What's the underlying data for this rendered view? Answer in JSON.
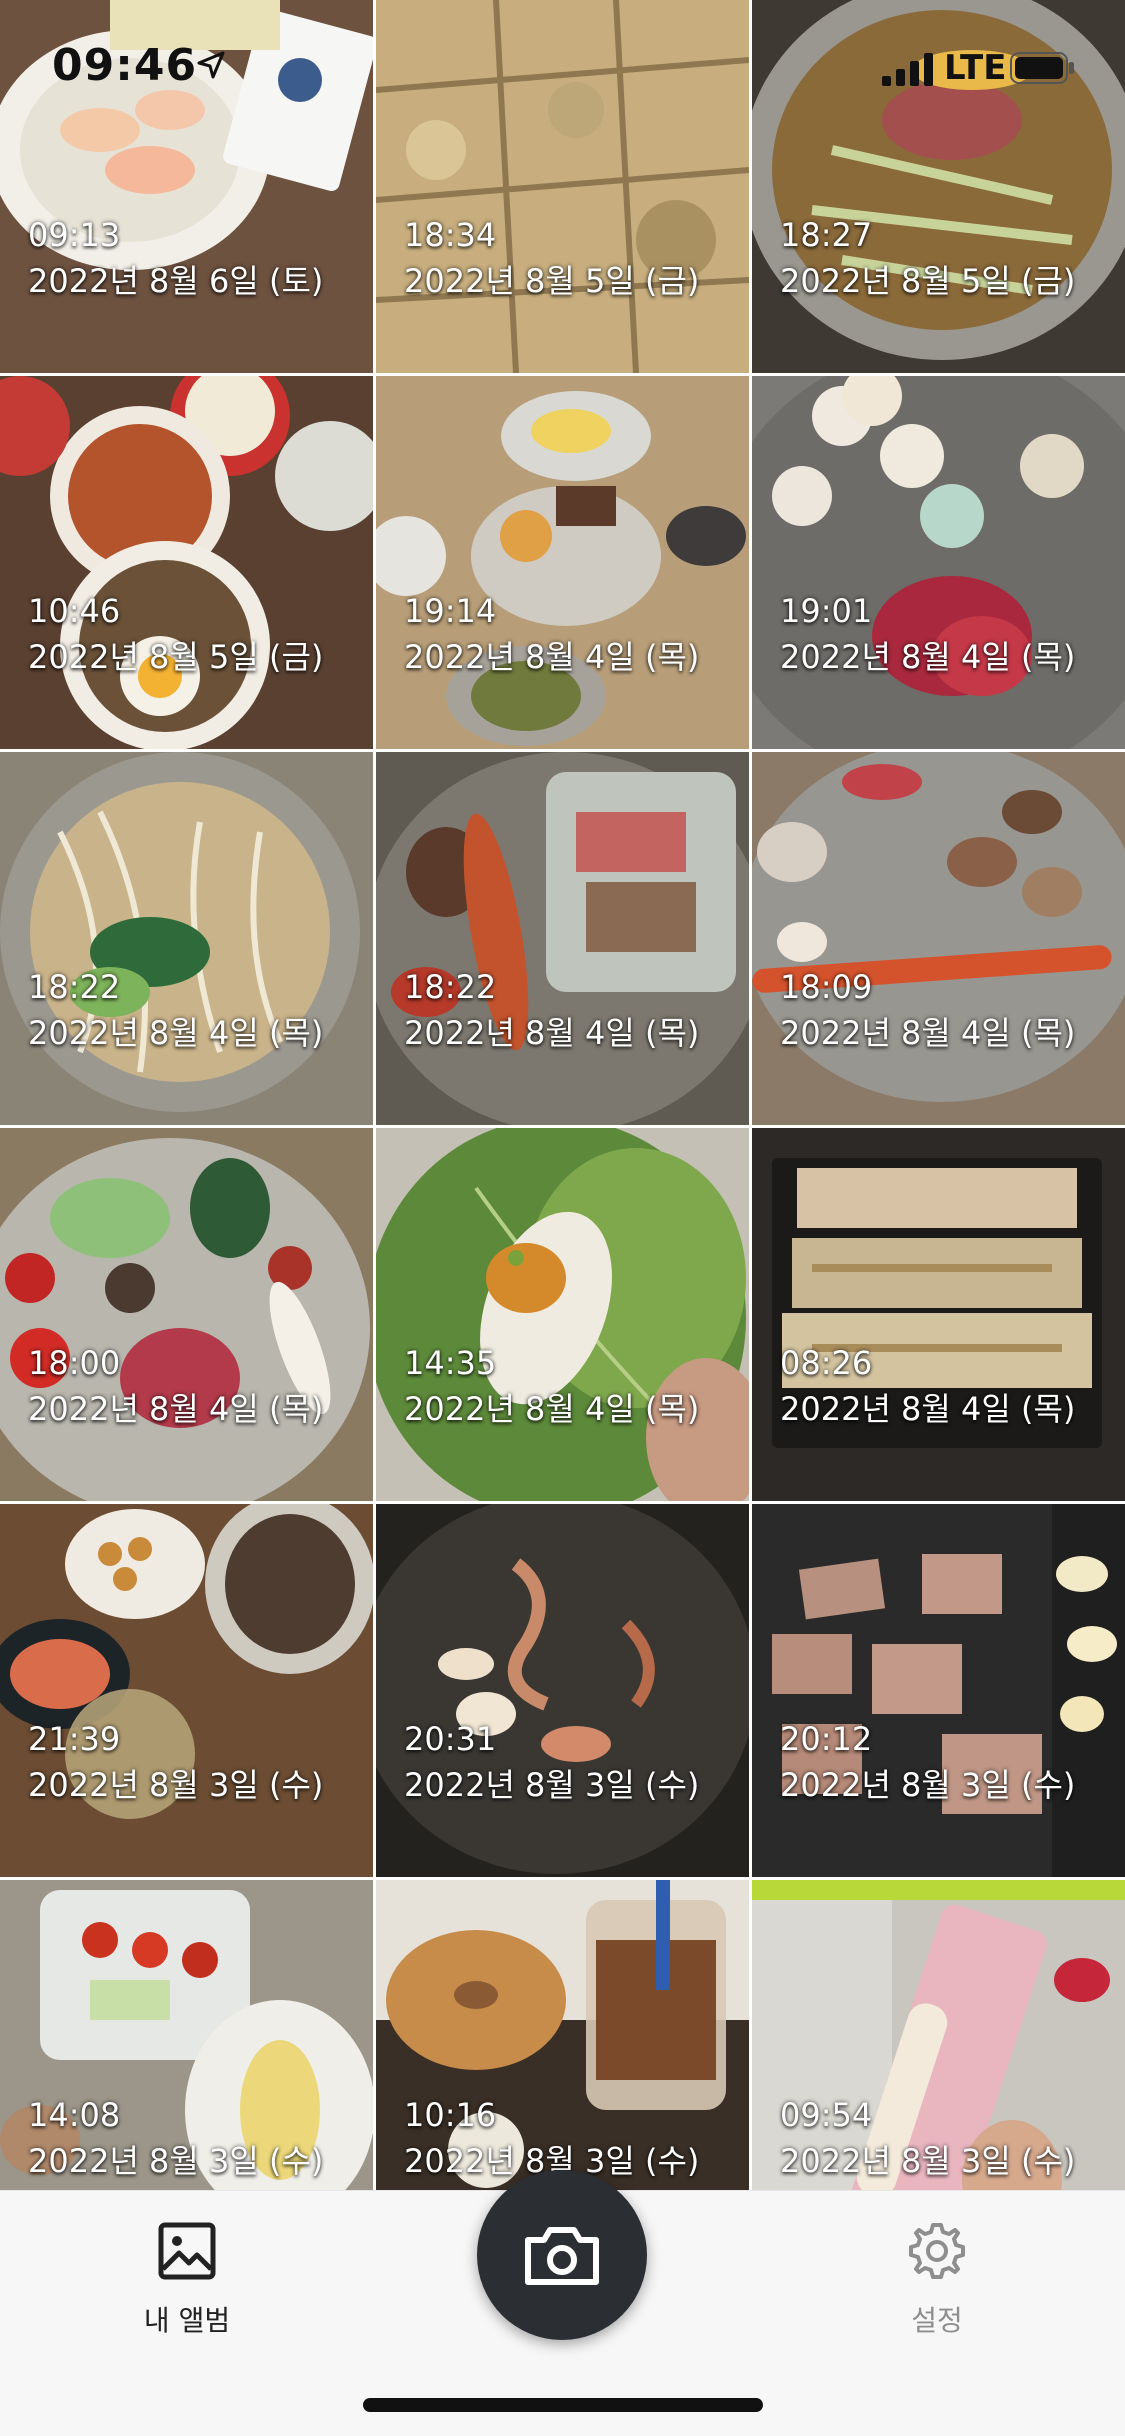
{
  "status_bar": {
    "time": "09:46",
    "network": "LTE"
  },
  "photos": [
    {
      "time": "09:13",
      "date": "2022년 8월 6일 (토)",
      "bg": "#7d5e4a"
    },
    {
      "time": "18:34",
      "date": "2022년 8월 5일 (금)",
      "bg": "#b79c70"
    },
    {
      "time": "18:27",
      "date": "2022년 8월 5일 (금)",
      "bg": "#6b5a3d"
    },
    {
      "time": "10:46",
      "date": "2022년 8월 5일 (금)",
      "bg": "#8a6a4f"
    },
    {
      "time": "19:14",
      "date": "2022년 8월 4일 (목)",
      "bg": "#9c8a70"
    },
    {
      "time": "19:01",
      "date": "2022년 8월 4일 (목)",
      "bg": "#7a7b78"
    },
    {
      "time": "18:22",
      "date": "2022년 8월 4일 (목)",
      "bg": "#8d8a78"
    },
    {
      "time": "18:22",
      "date": "2022년 8월 4일 (목)",
      "bg": "#6e6a62"
    },
    {
      "time": "18:09",
      "date": "2022년 8월 4일 (목)",
      "bg": "#8b8177"
    },
    {
      "time": "18:00",
      "date": "2022년 8월 4일 (목)",
      "bg": "#8f8a80"
    },
    {
      "time": "14:35",
      "date": "2022년 8월 4일 (목)",
      "bg": "#5e7d3f"
    },
    {
      "time": "08:26",
      "date": "2022년 8월 4일 (목)",
      "bg": "#4a3f33"
    },
    {
      "time": "21:39",
      "date": "2022년 8월 3일 (수)",
      "bg": "#6b4f36"
    },
    {
      "time": "20:31",
      "date": "2022년 8월 3일 (수)",
      "bg": "#2f2c2a"
    },
    {
      "time": "20:12",
      "date": "2022년 8월 3일 (수)",
      "bg": "#2b2a2a"
    },
    {
      "time": "14:08",
      "date": "2022년 8월 3일 (수)",
      "bg": "#8c8880"
    },
    {
      "time": "10:16",
      "date": "2022년 8월 3일 (수)",
      "bg": "#5b4a3a"
    },
    {
      "time": "09:54",
      "date": "2022년 8월 3일 (수)",
      "bg": "#a9a69c"
    }
  ],
  "tabbar": {
    "album_label": "내 앨범",
    "settings_label": "설정"
  }
}
